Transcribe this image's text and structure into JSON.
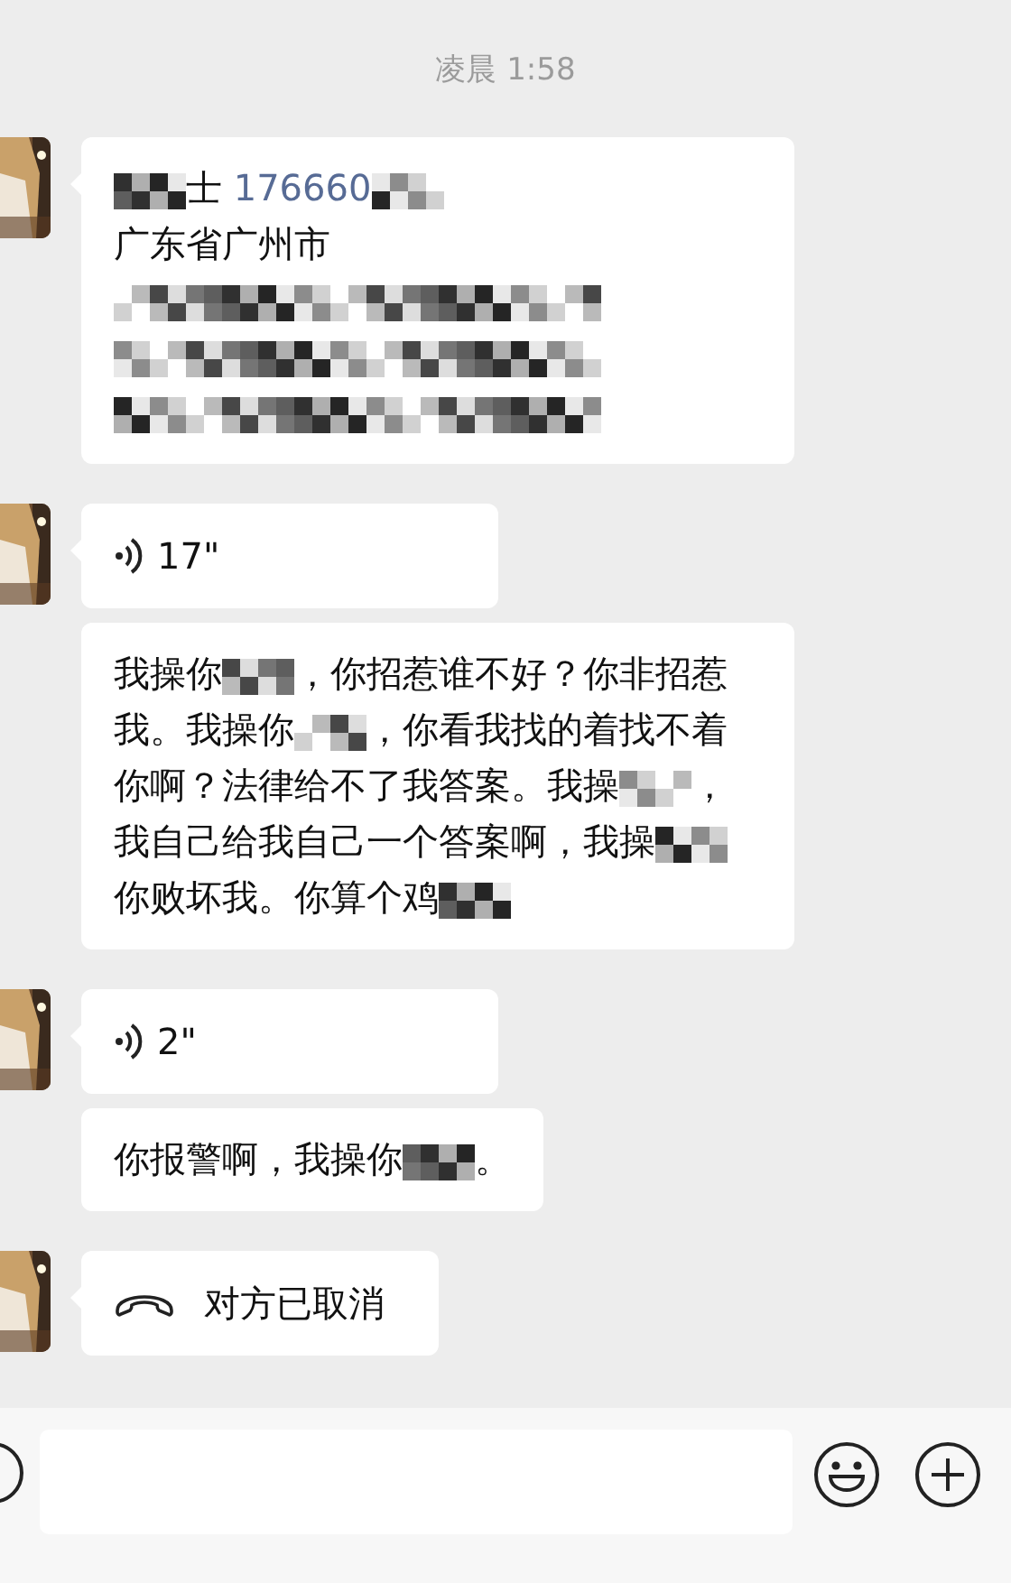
{
  "timestamp": "凌晨 1:58",
  "groups": [
    {
      "messages": [
        {
          "kind": "text",
          "segments": [
            {
              "kind": "mosaic"
            },
            {
              "kind": "text",
              "text": "士 "
            },
            {
              "kind": "link",
              "text": "176660"
            },
            {
              "kind": "mosaic"
            },
            {
              "kind": "break"
            },
            {
              "kind": "text",
              "text": "广东省广州市"
            },
            {
              "kind": "mosaic_line"
            },
            {
              "kind": "break"
            },
            {
              "kind": "mosaic_line"
            },
            {
              "kind": "break"
            },
            {
              "kind": "mosaic_line"
            }
          ]
        }
      ]
    },
    {
      "messages": [
        {
          "kind": "voice",
          "duration": "17\""
        },
        {
          "kind": "text",
          "segments": [
            {
              "kind": "text",
              "text": "我操你"
            },
            {
              "kind": "mosaic"
            },
            {
              "kind": "text",
              "text": "，你招惹谁不好？你非招惹我。我操你"
            },
            {
              "kind": "mosaic"
            },
            {
              "kind": "text",
              "text": "，你看我找的着找不着你啊？法律给不了我答案。我操"
            },
            {
              "kind": "mosaic"
            },
            {
              "kind": "text",
              "text": "，我自己给我自己一个答案啊，我操"
            },
            {
              "kind": "mosaic"
            },
            {
              "kind": "text",
              "text": "你败坏我。你算个鸡"
            },
            {
              "kind": "mosaic"
            }
          ]
        }
      ]
    },
    {
      "messages": [
        {
          "kind": "voice",
          "duration": "2\""
        },
        {
          "kind": "text",
          "segments": [
            {
              "kind": "text",
              "text": "你报警啊，我操你"
            },
            {
              "kind": "mosaic"
            },
            {
              "kind": "text",
              "text": "。"
            }
          ]
        }
      ]
    },
    {
      "messages": [
        {
          "kind": "call",
          "label": "对方已取消"
        }
      ]
    }
  ]
}
